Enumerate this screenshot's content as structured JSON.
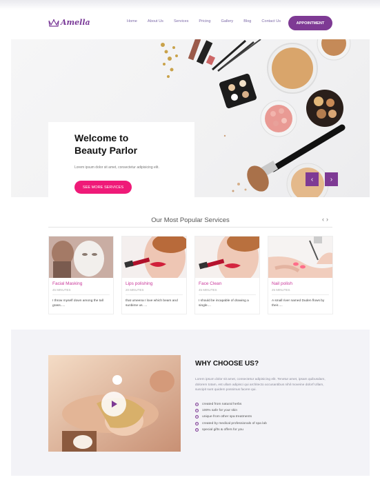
{
  "brand": {
    "name": "Amella",
    "logo_icon": "crown-icon",
    "accent": "#7e3a94",
    "pink": "#ef1a78"
  },
  "nav": {
    "items": [
      "Home",
      "About Us",
      "Services",
      "Pricing",
      "Gallery",
      "Blog",
      "Contact Us"
    ],
    "cta": "APPOINTMENT"
  },
  "hero": {
    "title_line1": "Welcome to",
    "title_line2": "Beauty Parlor",
    "text": "Lorem ipsum dolor sit amet, consectetur adipisicing elit.",
    "button": "SEE MORE SERVICES",
    "prev_icon": "chevron-left-icon",
    "next_icon": "chevron-right-icon"
  },
  "services": {
    "title": "Our Most Popular Services",
    "cards": [
      {
        "title": "Facial Masking",
        "duration": "45 MINUTES",
        "desc": "I throw myself down among the tall grass.....",
        "image": "facial-mask-photo"
      },
      {
        "title": "Lips polishing",
        "duration": "20 MINUTES",
        "desc": "that umeena I love which bears and sunbime us. ...",
        "image": "lipstick-photo"
      },
      {
        "title": "Face Clean",
        "duration": "45 MINUTES",
        "desc": "I should be incapable of drawing a single....",
        "image": "face-clean-photo"
      },
      {
        "title": "Nail polish",
        "duration": "25 MINUTES",
        "desc": "A small river named Duden flows by their.....",
        "image": "nail-polish-photo"
      }
    ]
  },
  "why": {
    "title": "WHY CHOOSE US?",
    "text": "Lorem ipsum dolor sit amet, consectetur adipisicing elit. Tenetur amet, ipsam quibusdam, dolorem totam, est ullam adipisci qui architecto accusantibus nihil moveine dolorf Ullam, suscipit sunt quidem possimus facere qui.",
    "items": [
      "created from natural herbs",
      "100% safe for your skin",
      "unique from other spa treatments",
      "created by medical professionals of spa lab",
      "special gifts & offers for you"
    ]
  }
}
